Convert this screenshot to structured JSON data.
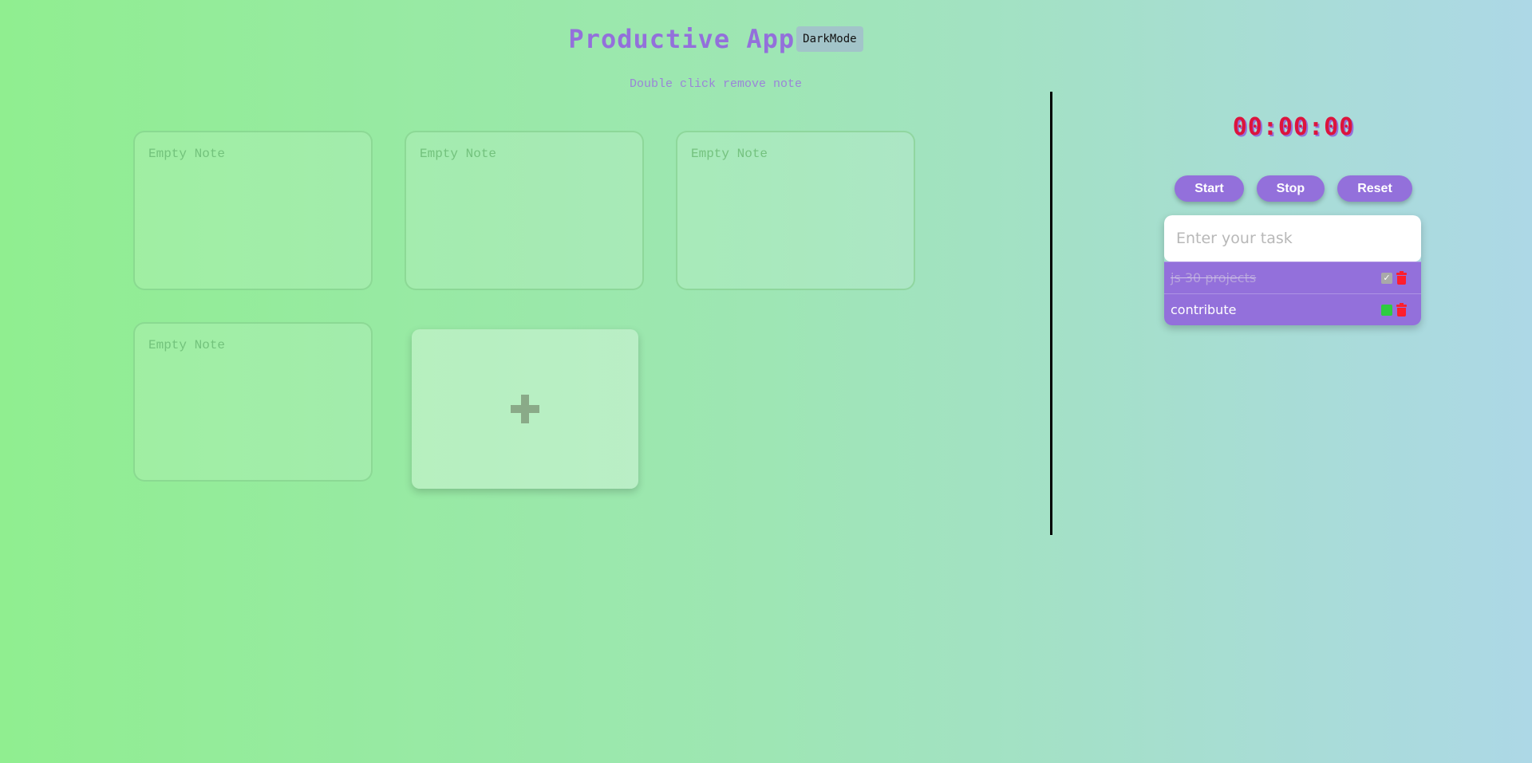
{
  "header": {
    "title": "Productive App",
    "darkmode_label": "DarkMode"
  },
  "hint": "Double click remove note",
  "notes": [
    {
      "placeholder": "Empty Note"
    },
    {
      "placeholder": "Empty Note"
    },
    {
      "placeholder": "Empty Note"
    },
    {
      "placeholder": "Empty Note"
    }
  ],
  "add_note": {
    "icon": "plus-icon"
  },
  "timer": {
    "display": "00:00:00",
    "start_label": "Start",
    "stop_label": "Stop",
    "reset_label": "Reset"
  },
  "todo": {
    "placeholder": "Enter your task",
    "tasks": [
      {
        "text": "js 30 projects",
        "done": true
      },
      {
        "text": "contribute",
        "done": false
      }
    ]
  },
  "colors": {
    "accent": "#9370db",
    "timer": "#dc143c",
    "delete": "#ff1e2d",
    "check_done": "#a9a9a9",
    "check_open": "#2ecc40"
  }
}
